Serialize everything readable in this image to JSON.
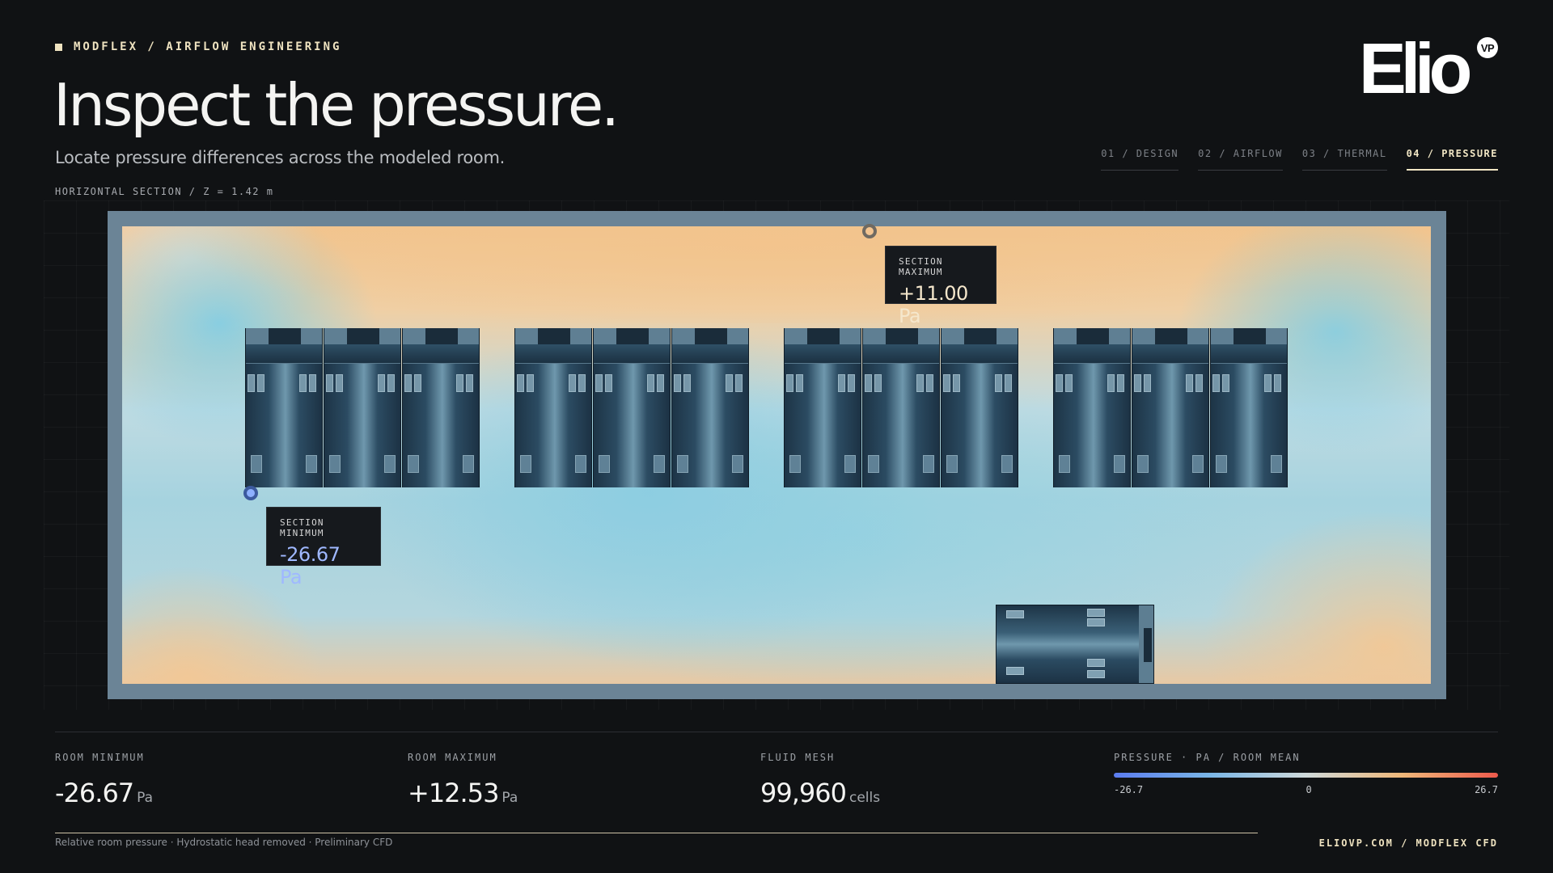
{
  "header": {
    "eyebrow": "MODFLEX / AIRFLOW ENGINEERING",
    "title": "Inspect the pressure.",
    "subtitle": "Locate pressure differences across the modeled room.",
    "section_label": "HORIZONTAL SECTION / Z = 1.42 m"
  },
  "logo": {
    "text": "Elio",
    "badge": "VP"
  },
  "tabs": [
    {
      "label": "01 / DESIGN",
      "active": false
    },
    {
      "label": "02 / AIRFLOW",
      "active": false
    },
    {
      "label": "03 / THERMAL",
      "active": false
    },
    {
      "label": "04 / PRESSURE",
      "active": true
    }
  ],
  "plot": {
    "max_callout": {
      "label": "SECTION MAXIMUM",
      "value": "+11.00 Pa"
    },
    "min_callout": {
      "label": "SECTION MINIMUM",
      "value": "-26.67 Pa"
    },
    "unit_rows": 1,
    "unit_groups": 4,
    "units_per_group": 3
  },
  "stats": [
    {
      "label": "ROOM MINIMUM",
      "value": "-26.67",
      "unit": "Pa"
    },
    {
      "label": "ROOM MAXIMUM",
      "value": "+12.53",
      "unit": "Pa"
    },
    {
      "label": "FLUID MESH",
      "value": "99,960",
      "unit": "cells"
    }
  ],
  "scale": {
    "label": "PRESSURE · PA / ROOM MEAN",
    "min": "-26.7",
    "mid": "0",
    "max": "26.7",
    "colors": [
      "#5b7cf0",
      "#7ab6e6",
      "#cfd9da",
      "#efb87a",
      "#ee5a4c"
    ]
  },
  "footer": {
    "note": "Relative room pressure · Hydrostatic head removed · Preliminary CFD",
    "credit": "ELIOVP.COM / MODFLEX CFD"
  }
}
